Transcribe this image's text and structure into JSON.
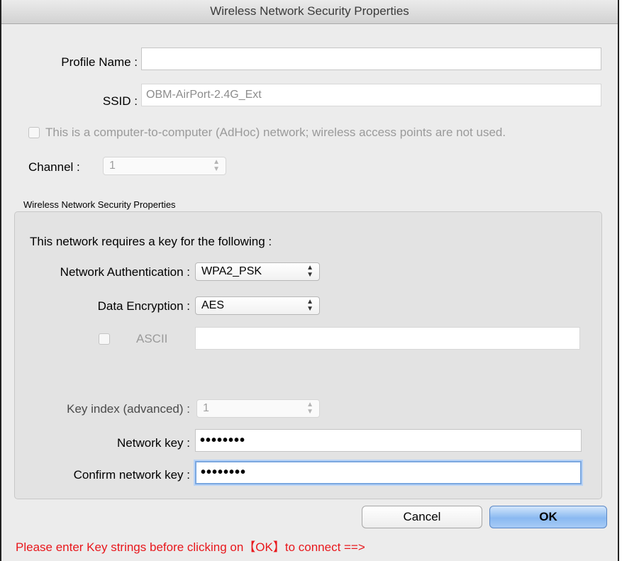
{
  "window": {
    "title": "Wireless Network Security Properties"
  },
  "profile": {
    "label": "Profile Name :",
    "value": ""
  },
  "ssid": {
    "label": "SSID :",
    "value": "OBM-AirPort-2.4G_Ext"
  },
  "adhoc": {
    "label": "This is a computer-to-computer (AdHoc) network; wireless access points are not used.",
    "checked": false
  },
  "channel": {
    "label": "Channel :",
    "value": "1"
  },
  "security": {
    "group_label": "Wireless Network Security Properties",
    "requires_key_text": "This network requires a key for the following :",
    "auth_label": "Network Authentication :",
    "auth_value": "WPA2_PSK",
    "enc_label": "Data Encryption :",
    "enc_value": "AES",
    "ascii_label": "ASCII",
    "ascii_value": "",
    "key_index_label": "Key index (advanced) :",
    "key_index_value": "1",
    "network_key_label": "Network key :",
    "network_key_value": "••••••••",
    "confirm_key_label": "Confirm network key :",
    "confirm_key_value": "••••••••"
  },
  "buttons": {
    "cancel": "Cancel",
    "ok": "OK"
  },
  "message": "Please enter Key strings before clicking on【OK】to connect ==>",
  "colors": {
    "message": "#e8171c",
    "ok_button": "#8ab9f1",
    "focus_ring": "#7aa7e0"
  }
}
